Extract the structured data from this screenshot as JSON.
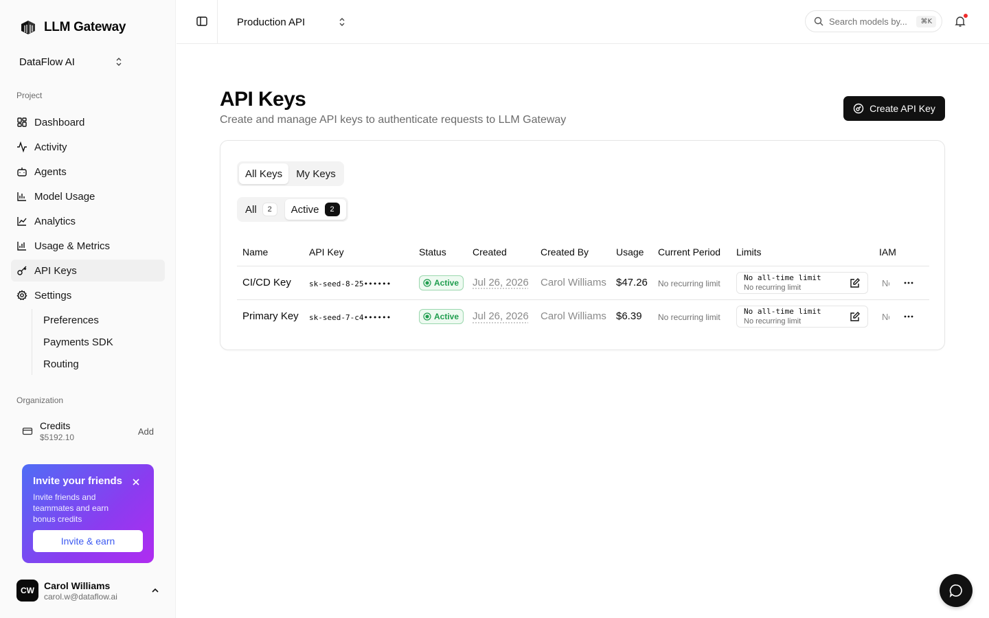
{
  "brand": {
    "name": "LLM Gateway"
  },
  "org": {
    "name": "DataFlow AI"
  },
  "sidebar": {
    "project_label": "Project",
    "items": [
      {
        "label": "Dashboard",
        "icon": "dashboard-icon"
      },
      {
        "label": "Activity",
        "icon": "activity-icon"
      },
      {
        "label": "Agents",
        "icon": "bot-icon"
      },
      {
        "label": "Model Usage",
        "icon": "bar-chart-icon"
      },
      {
        "label": "Analytics",
        "icon": "line-chart-icon"
      },
      {
        "label": "Usage & Metrics",
        "icon": "bar-chart-icon"
      },
      {
        "label": "API Keys",
        "icon": "key-icon",
        "active": true
      },
      {
        "label": "Settings",
        "icon": "gear-icon"
      }
    ],
    "settings_sub": [
      "Preferences",
      "Payments SDK",
      "Routing"
    ],
    "org_label": "Organization",
    "credits": {
      "label": "Credits",
      "amount": "$5192.10",
      "add": "Add"
    },
    "invite": {
      "title": "Invite your friends",
      "body": "Invite friends and teammates and earn bonus credits",
      "button": "Invite & earn"
    },
    "user": {
      "initials": "CW",
      "name": "Carol Williams",
      "email": "carol.w@dataflow.ai"
    }
  },
  "topbar": {
    "project": "Production API",
    "search_placeholder": "Search models by...",
    "search_shortcut": "⌘K"
  },
  "page": {
    "title": "API Keys",
    "subtitle": "Create and manage API keys to authenticate requests to LLM Gateway",
    "create_button": "Create API Key"
  },
  "tabs": {
    "all_keys": "All Keys",
    "my_keys": "My Keys"
  },
  "filters": {
    "all": "All",
    "all_count": "2",
    "active": "Active",
    "active_count": "2"
  },
  "table": {
    "headers": [
      "Name",
      "API Key",
      "Status",
      "Created",
      "Created By",
      "Usage",
      "Current Period",
      "Limits",
      "IAM"
    ],
    "rows": [
      {
        "name": "CI/CD Key",
        "key": "sk-seed-8-25••••••",
        "status": "Active",
        "created": "Jul 26, 2026",
        "created_by": "Carol Williams",
        "usage": "$47.26",
        "period": "No recurring limit",
        "limit_alltime": "No all-time limit",
        "limit_recurring": "No recurring limit",
        "iam": "No"
      },
      {
        "name": "Primary Key",
        "key": "sk-seed-7-c4••••••",
        "status": "Active",
        "created": "Jul 26, 2026",
        "created_by": "Carol Williams",
        "usage": "$6.39",
        "period": "No recurring limit",
        "limit_alltime": "No all-time limit",
        "limit_recurring": "No recurring limit",
        "iam": "No"
      }
    ]
  },
  "colors": {
    "accent": "#111111",
    "active_green": "#1f9d4e",
    "notification": "#ef2b2b"
  }
}
